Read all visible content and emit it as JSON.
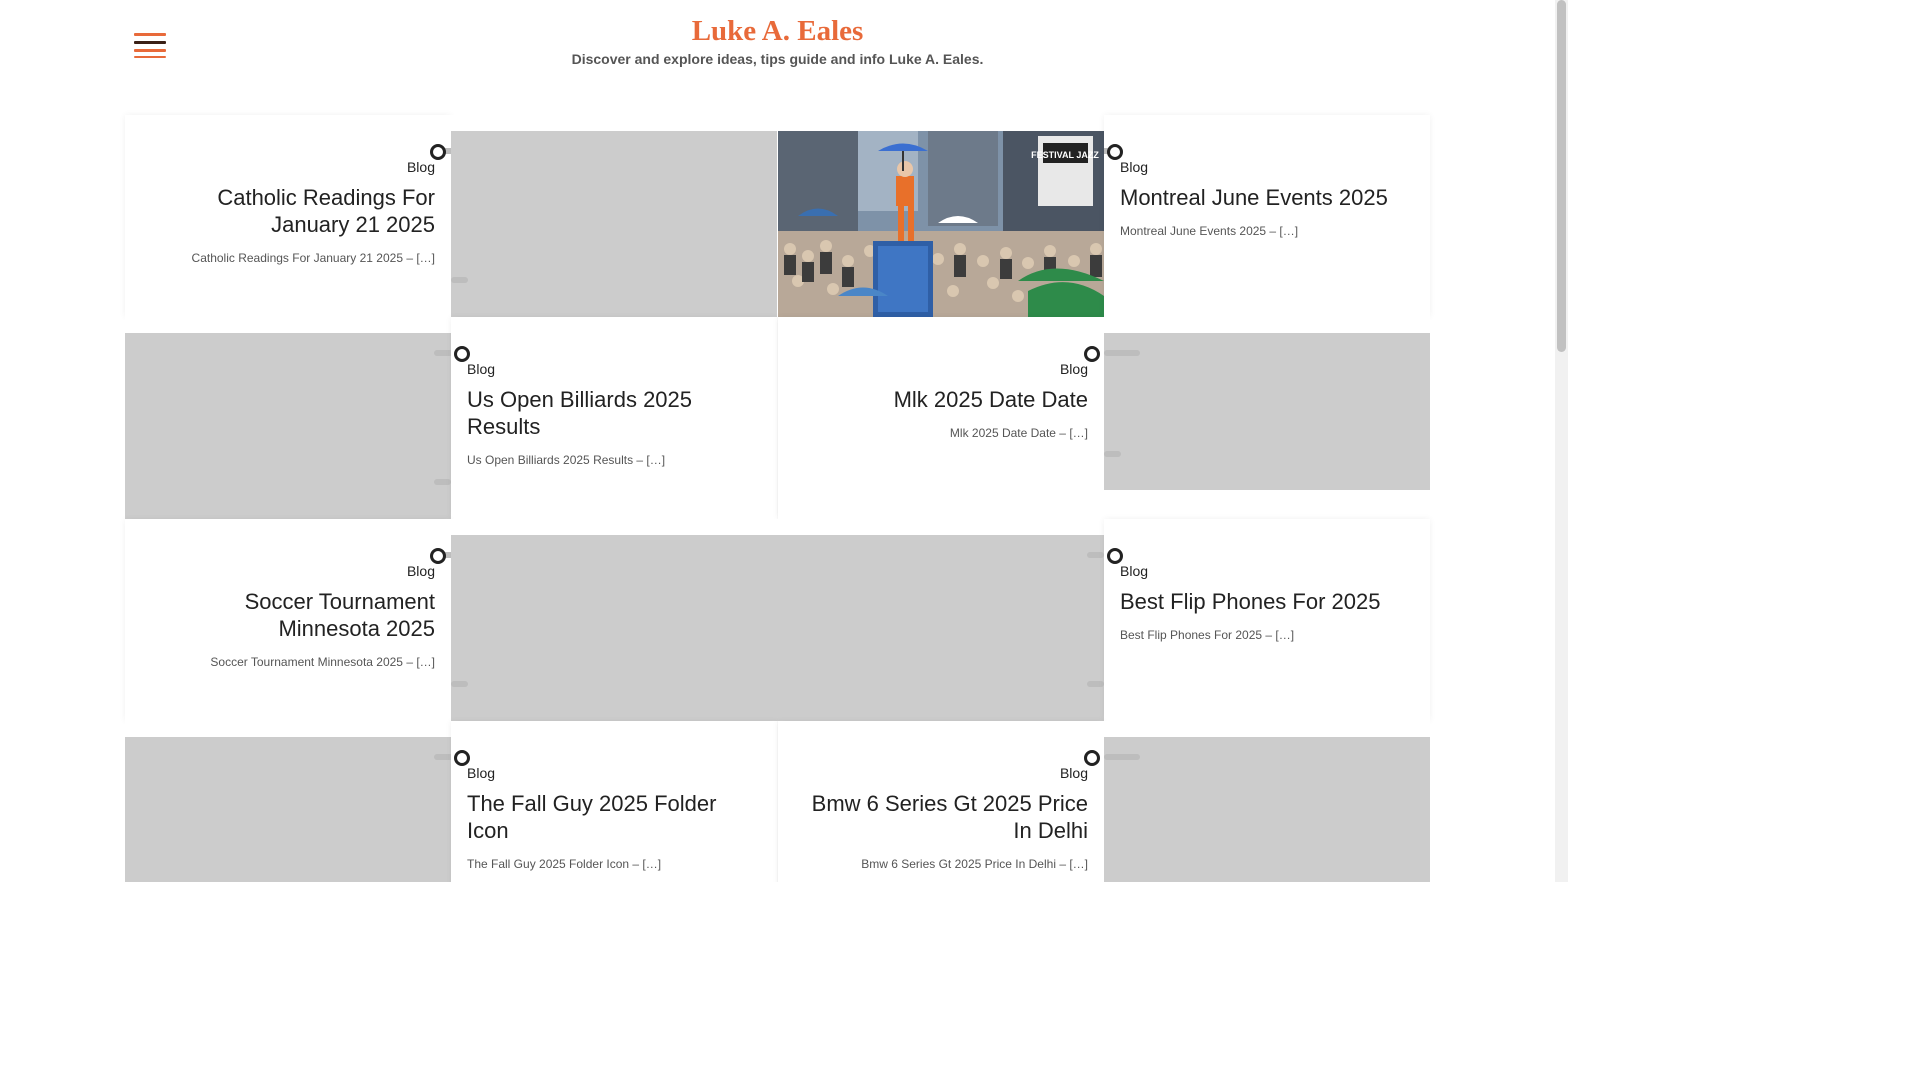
{
  "header": {
    "title": "Luke A. Eales",
    "tagline": "Discover and explore ideas, tips guide and info Luke A. Eales.",
    "menu_icon": "hamburger-menu-icon",
    "accent_color": "#e86a3a"
  },
  "posts": [
    {
      "category": "Blog",
      "title": "Catholic Readings For January 21 2025",
      "excerpt": "Catholic Readings For January 21 2025 – […]"
    },
    {
      "category": "Blog",
      "title": "Montreal June Events 2025",
      "excerpt": "Montreal June Events 2025 – […]"
    },
    {
      "category": "Blog",
      "title": "Us Open Billiards 2025 Results",
      "excerpt": "Us Open Billiards 2025 Results – […]"
    },
    {
      "category": "Blog",
      "title": "Mlk 2025 Date Date",
      "excerpt": "Mlk 2025 Date Date – […]"
    },
    {
      "category": "Blog",
      "title": "Soccer Tournament Minnesota 2025",
      "excerpt": "Soccer Tournament Minnesota 2025 – […]"
    },
    {
      "category": "Blog",
      "title": "Best Flip Phones For 2025",
      "excerpt": "Best Flip Phones For 2025 – […]"
    },
    {
      "category": "Blog",
      "title": "The Fall Guy 2025 Folder Icon",
      "excerpt": "The Fall Guy 2025 Folder Icon – […]"
    },
    {
      "category": "Blog",
      "title": "Bmw 6 Series Gt 2025 Price In Delhi",
      "excerpt": "Bmw 6 Series Gt 2025 Price In Delhi – […]"
    }
  ],
  "photo": {
    "sign_text": "FESTIVAL JAZZ"
  }
}
